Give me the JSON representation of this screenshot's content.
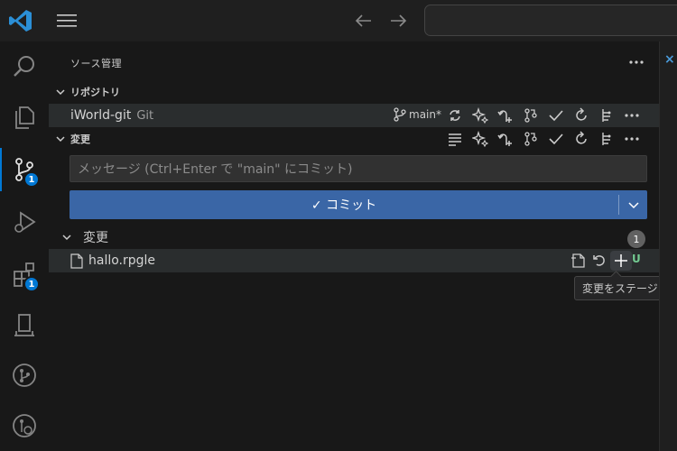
{
  "titlebar": {
    "logo_icon": "vscode-logo-icon",
    "menu_icon": "hamburger-menu-icon",
    "back_icon": "arrow-left-icon",
    "forward_icon": "arrow-right-icon"
  },
  "activity": {
    "items": [
      {
        "name": "explorer-search",
        "icon": "search-icon"
      },
      {
        "name": "explorer",
        "icon": "files-icon"
      },
      {
        "name": "source-control",
        "icon": "source-control-icon",
        "badge": "1"
      },
      {
        "name": "run-debug",
        "icon": "run-debug-icon"
      },
      {
        "name": "extensions",
        "icon": "extensions-icon",
        "badge": "1"
      },
      {
        "name": "remote",
        "icon": "ibm-i-icon"
      },
      {
        "name": "git-graph",
        "icon": "git-graph-icon"
      },
      {
        "name": "git-history",
        "icon": "git-history-icon"
      }
    ]
  },
  "sidebar": {
    "title": "ソース管理",
    "repositories_header": "リポジトリ",
    "repo": {
      "name": "iWorld-git",
      "type": "Git",
      "branch": "main*"
    },
    "changes_section_header": "変更",
    "message_placeholder": "メッセージ (Ctrl+Enter で \"main\" にコミット)",
    "commit_label": "✓ コミット",
    "changes_group": {
      "label": "変更",
      "count": "1"
    },
    "files": [
      {
        "name": "hallo.rpgle",
        "status": "U"
      }
    ],
    "tooltip": "変更をステージ"
  },
  "colors": {
    "accent": "#0078d4",
    "commit_button": "#3a66a6",
    "untracked": "#73c991"
  }
}
